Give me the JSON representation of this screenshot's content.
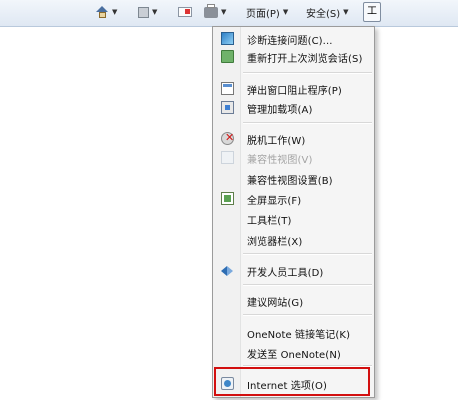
{
  "toolbar": {
    "home_icon": "home-icon",
    "feeds_icon": "feeds-icon",
    "mail_icon": "read-mail-icon",
    "print_icon": "print-icon",
    "page_label": "页面(P)",
    "safety_label": "安全(S)",
    "tools_label": "工"
  },
  "menu": {
    "items": [
      {
        "label": "诊断连接问题(C)...",
        "icon": "diagnose-connection-icon",
        "enabled": true
      },
      {
        "label": "重新打开上次浏览会话(S)",
        "icon": "reopen-session-icon",
        "enabled": true
      },
      {
        "label": "弹出窗口阻止程序(P)",
        "icon": "popup-blocker-icon",
        "enabled": true
      },
      {
        "label": "管理加载项(A)",
        "icon": "manage-addons-icon",
        "enabled": true
      },
      {
        "label": "脱机工作(W)",
        "icon": "work-offline-icon",
        "enabled": true
      },
      {
        "label": "兼容性视图(V)",
        "icon": "compatibility-view-icon",
        "enabled": false
      },
      {
        "label": "兼容性视图设置(B)",
        "icon": "",
        "enabled": true
      },
      {
        "label": "全屏显示(F)",
        "icon": "full-screen-icon",
        "enabled": true
      },
      {
        "label": "工具栏(T)",
        "icon": "",
        "enabled": true
      },
      {
        "label": "浏览器栏(X)",
        "icon": "",
        "enabled": true
      },
      {
        "label": "开发人员工具(D)",
        "icon": "developer-tools-icon",
        "enabled": true
      },
      {
        "label": "建议网站(G)",
        "icon": "",
        "enabled": true
      },
      {
        "label": "OneNote 链接笔记(K)",
        "icon": "",
        "enabled": true
      },
      {
        "label": "发送至 OneNote(N)",
        "icon": "",
        "enabled": true
      },
      {
        "label": "Internet 选项(O)",
        "icon": "internet-options-icon",
        "enabled": true,
        "highlighted": true
      }
    ]
  },
  "colors": {
    "highlight_border": "#d20f0f",
    "menu_background": "#f5f5f5",
    "disabled_text": "#a3a3a3"
  }
}
